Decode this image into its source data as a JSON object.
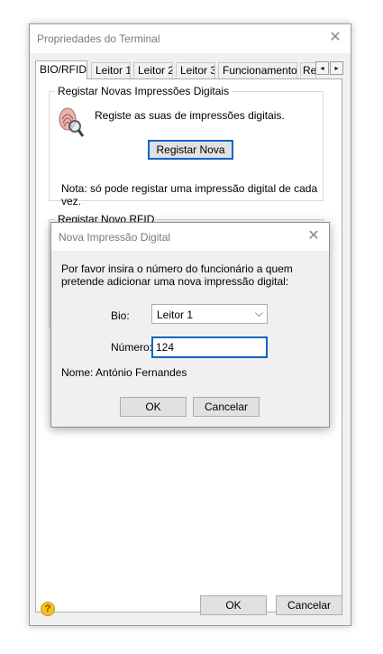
{
  "window": {
    "title": "Propriedades do Terminal",
    "close_glyph": "✕",
    "tabs": [
      "BIO/RFID",
      "Leitor 1",
      "Leitor 2",
      "Leitor 3",
      "Funcionamento",
      "Rel"
    ],
    "tab_left_glyph": "◂",
    "tab_right_glyph": "▸",
    "groups": {
      "fingerprint": {
        "label": "Registar Novas Impressões Digitais",
        "description": "Registe as suas de impressões digitais.",
        "button": "Registar Nova",
        "note": "Nota: só pode registar uma impressão digital de cada vez."
      },
      "rfid": {
        "label": "Registar Novo RFID"
      }
    },
    "ok_label": "OK",
    "cancel_label": "Cancelar",
    "help_glyph": "?"
  },
  "dialog": {
    "title": "Nova Impressão Digital",
    "close_glyph": "✕",
    "instruction": "Por favor insira o número do funcionário a quem pretende adicionar uma nova impressão digital:",
    "bio_label": "Bio:",
    "bio_value": "Leitor 1",
    "chev_glyph": "⌵",
    "number_label": "Número:",
    "number_value": "124",
    "name_text": "Nome: António Fernandes",
    "ok_label": "OK",
    "cancel_label": "Cancelar"
  },
  "colors": {
    "focus_blue": "#0a64c8",
    "window_bg": "#f0f0f0",
    "help_icon": "#f3c315"
  }
}
